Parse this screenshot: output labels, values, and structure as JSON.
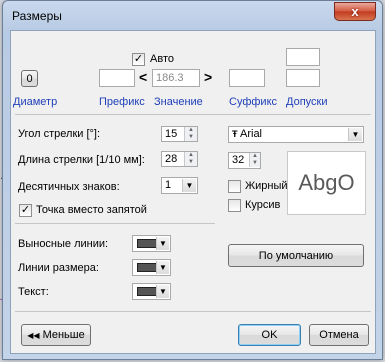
{
  "window": {
    "title": "Размеры",
    "close_glyph": "x"
  },
  "top": {
    "auto_label": "Авто",
    "auto_checked": true,
    "diameter_btn": "0",
    "diameter_label": "Диаметр",
    "prefix_label": "Префикс",
    "value_label": "Значение",
    "value": "186.3",
    "less": "<",
    "greater": ">",
    "suffix_label": "Суффикс",
    "tolerance_label": "Допуски"
  },
  "params": {
    "arrow_angle_label": "Угол стрелки [°]:",
    "arrow_angle_value": "15",
    "arrow_length_label": "Длина стрелки [1/10 мм]:",
    "arrow_length_value": "28",
    "decimals_label": "Десятичных знаков:",
    "decimals_value": "1",
    "point_label": "Точка вместо запятой",
    "point_checked": true
  },
  "font": {
    "name": "Arial",
    "size": "32",
    "bold_label": "Жирный",
    "italic_label": "Курсив",
    "preview": "AbgO"
  },
  "lines": {
    "extension_label": "Выносные линии:",
    "dimension_label": "Линии размера:",
    "text_label": "Текст:"
  },
  "buttons": {
    "default": "По умолчанию",
    "less": "Меньше",
    "ok": "OK",
    "cancel": "Отмена"
  }
}
